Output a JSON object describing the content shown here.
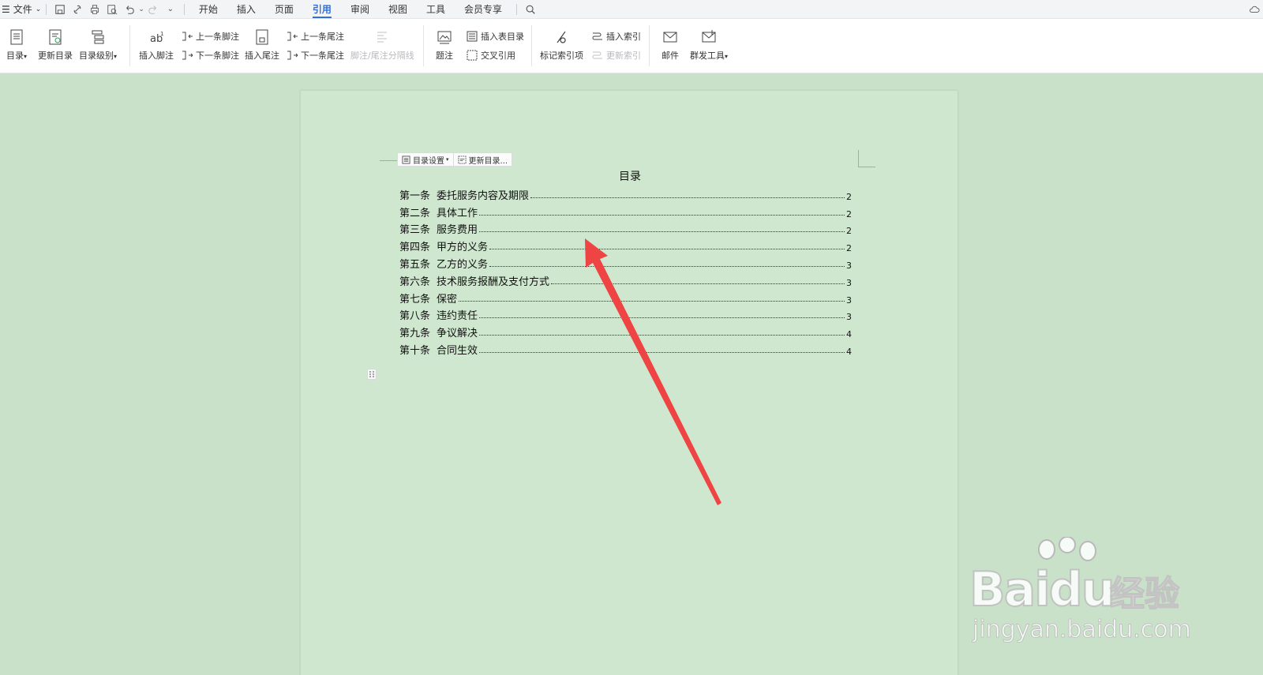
{
  "menubar": {
    "file_label": "文件",
    "tabs": [
      {
        "label": "开始",
        "active": false
      },
      {
        "label": "插入",
        "active": false
      },
      {
        "label": "页面",
        "active": false
      },
      {
        "label": "引用",
        "active": true
      },
      {
        "label": "审阅",
        "active": false
      },
      {
        "label": "视图",
        "active": false
      },
      {
        "label": "工具",
        "active": false
      },
      {
        "label": "会员专享",
        "active": false
      }
    ]
  },
  "ribbon": {
    "toc": "目录",
    "update_toc": "更新目录",
    "toc_level": "目录级别",
    "insert_footnote": "插入脚注",
    "prev_footnote": "上一条脚注",
    "next_footnote": "下一条脚注",
    "insert_endnote": "插入尾注",
    "prev_endnote": "上一条尾注",
    "next_endnote": "下一条尾注",
    "note_separator": "脚注/尾注分隔线",
    "caption": "题注",
    "insert_table_of_figures": "插入表目录",
    "cross_reference": "交叉引用",
    "mark_index_entry": "标记索引项",
    "insert_index": "插入索引",
    "update_index": "更新索引",
    "mail": "邮件",
    "mass_mail_tool": "群发工具"
  },
  "document": {
    "toc_toolbar": {
      "settings": "目录设置",
      "update": "更新目录..."
    },
    "toc_title": "目录",
    "toc_entries": [
      {
        "num": "第一条",
        "title": "委托服务内容及期限",
        "page": "2"
      },
      {
        "num": "第二条",
        "title": "具体工作",
        "page": "2"
      },
      {
        "num": "第三条",
        "title": "服务费用",
        "page": "2"
      },
      {
        "num": "第四条",
        "title": "甲方的义务",
        "page": "2"
      },
      {
        "num": "第五条",
        "title": "乙方的义务",
        "page": "3"
      },
      {
        "num": "第六条",
        "title": "技术服务报酬及支付方式",
        "page": "3"
      },
      {
        "num": "第七条",
        "title": "保密",
        "page": "3"
      },
      {
        "num": "第八条",
        "title": "违约责任",
        "page": "3"
      },
      {
        "num": "第九条",
        "title": "争议解决",
        "page": "4"
      },
      {
        "num": "第十条",
        "title": "合同生效",
        "page": "4"
      }
    ]
  },
  "watermark": {
    "brand": "Bai",
    "brand2": "du",
    "cn": "经验",
    "url": "jingyan.baidu.com"
  },
  "colors": {
    "accent": "#2f6fe0",
    "page_bg": "#cfe7cf",
    "workspace_bg": "#c9e1c9",
    "arrow": "#ef4444"
  }
}
